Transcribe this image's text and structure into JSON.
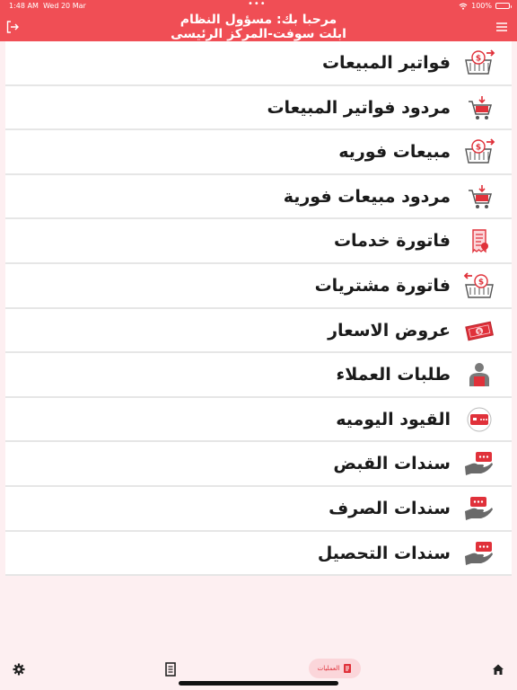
{
  "status_bar": {
    "time": "1:48 AM",
    "date": "Wed 20 Mar",
    "battery": "100%",
    "battery_level": 1.0,
    "wifi_icon": "wifi-icon"
  },
  "header": {
    "greeting_line": "مرحبا بك: مسؤول النظام",
    "company_line": "ابلت سوفت-المركز الرئيسى",
    "left_icon": "logout-icon",
    "right_icon": "hamburger-menu-icon"
  },
  "menu": {
    "items": [
      {
        "label": "فواتير المبيعات",
        "icon": "sales-basket-icon"
      },
      {
        "label": "مردود فواتير المبيعات",
        "icon": "return-cart-icon"
      },
      {
        "label": "مبيعات فوريه",
        "icon": "sales-basket-icon"
      },
      {
        "label": "مردود مبيعات فورية",
        "icon": "return-cart-icon"
      },
      {
        "label": "فاتورة خدمات",
        "icon": "receipt-icon"
      },
      {
        "label": "فاتورة مشتريات",
        "icon": "purchase-basket-icon"
      },
      {
        "label": "عروض الاسعار",
        "icon": "money-bill-icon"
      },
      {
        "label": "طلبات العملاء",
        "icon": "customer-icon"
      },
      {
        "label": "القيود اليوميه",
        "icon": "journal-card-icon"
      },
      {
        "label": "سندات القبض",
        "icon": "hand-card-icon"
      },
      {
        "label": "سندات الصرف",
        "icon": "hand-card-icon"
      },
      {
        "label": "سندات التحصيل",
        "icon": "hand-card-icon"
      }
    ]
  },
  "tabbar": {
    "operations_label": "العمليات",
    "icons": [
      "gear-icon",
      "document-icon",
      "operations-icon",
      "home-icon"
    ]
  },
  "colors": {
    "brand": "#f04e55",
    "background": "#fdeff1",
    "accent_dark": "#e0313a"
  }
}
